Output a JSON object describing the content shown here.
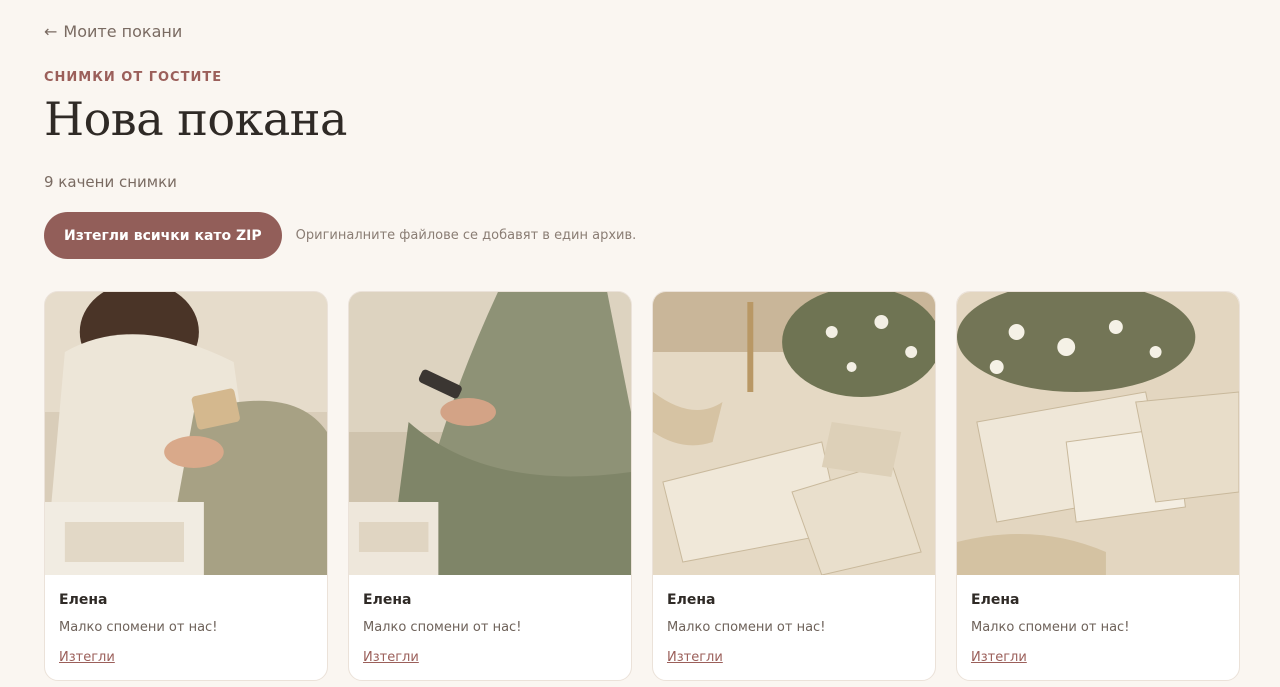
{
  "nav": {
    "back_label": "Моите покани",
    "back_arrow": "←"
  },
  "header": {
    "eyebrow": "СНИМКИ ОТ ГОСТИТЕ",
    "title": "Нова покана",
    "count_text": "9 качени снимки"
  },
  "actions": {
    "zip_label": "Изтегли всички като ZIP",
    "zip_note": "Оригиналните файлове се добавят в един архив."
  },
  "photos": [
    {
      "author": "Елена",
      "message": "Малко спомени от нас!",
      "download_label": "Изтегли",
      "subject": "woman-with-phone-photo"
    },
    {
      "author": "Елена",
      "message": "Малко спомени от нас!",
      "download_label": "Изтегли",
      "subject": "woman-with-phone-photo"
    },
    {
      "author": "Елена",
      "message": "Малко спомени от нас!",
      "download_label": "Изтегли",
      "subject": "invitation-flatlay-photo"
    },
    {
      "author": "Елена",
      "message": "Малко спомени от нас!",
      "download_label": "Изтегли",
      "subject": "invitation-flatlay-photo"
    }
  ],
  "colors": {
    "background": "#faf6f1",
    "accent": "#925e59",
    "eyebrow": "#9b5f5a",
    "muted_text": "#7a6b62"
  }
}
